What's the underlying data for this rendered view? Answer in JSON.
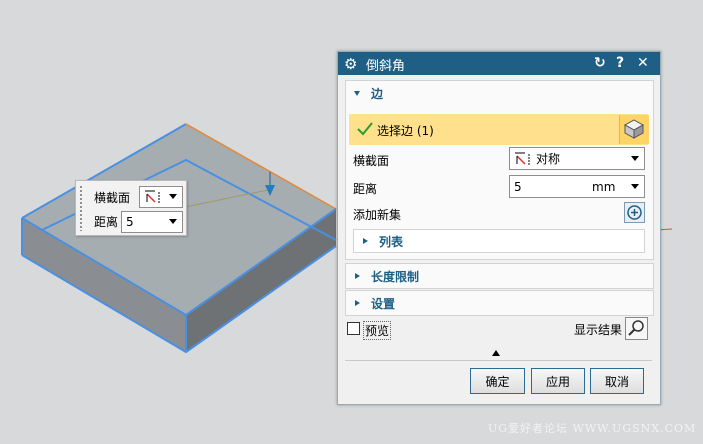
{
  "dialog": {
    "title": "倒斜角",
    "edge_group": {
      "title": "边",
      "select_label": "选择边 (1)",
      "cross_section_label": "横截面",
      "cross_section_value": "对称",
      "distance_label": "距离",
      "distance_value": "5",
      "distance_unit": "mm",
      "add_new_set_label": "添加新集",
      "list_label": "列表"
    },
    "length_limit_title": "长度限制",
    "settings_title": "设置",
    "preview_label": "预览",
    "show_result_label": "显示结果",
    "ok_label": "确定",
    "apply_label": "应用",
    "cancel_label": "取消"
  },
  "mini_panel": {
    "cross_section_label": "横截面",
    "distance_label": "距离",
    "distance_value": "5"
  },
  "watermark": "UG爱好者论坛 WWW.UGSNX.COM",
  "colors": {
    "title_bar": "#1f5f86",
    "selection_highlight": "#ffe08c",
    "edge_highlight": "#4a90e2"
  }
}
